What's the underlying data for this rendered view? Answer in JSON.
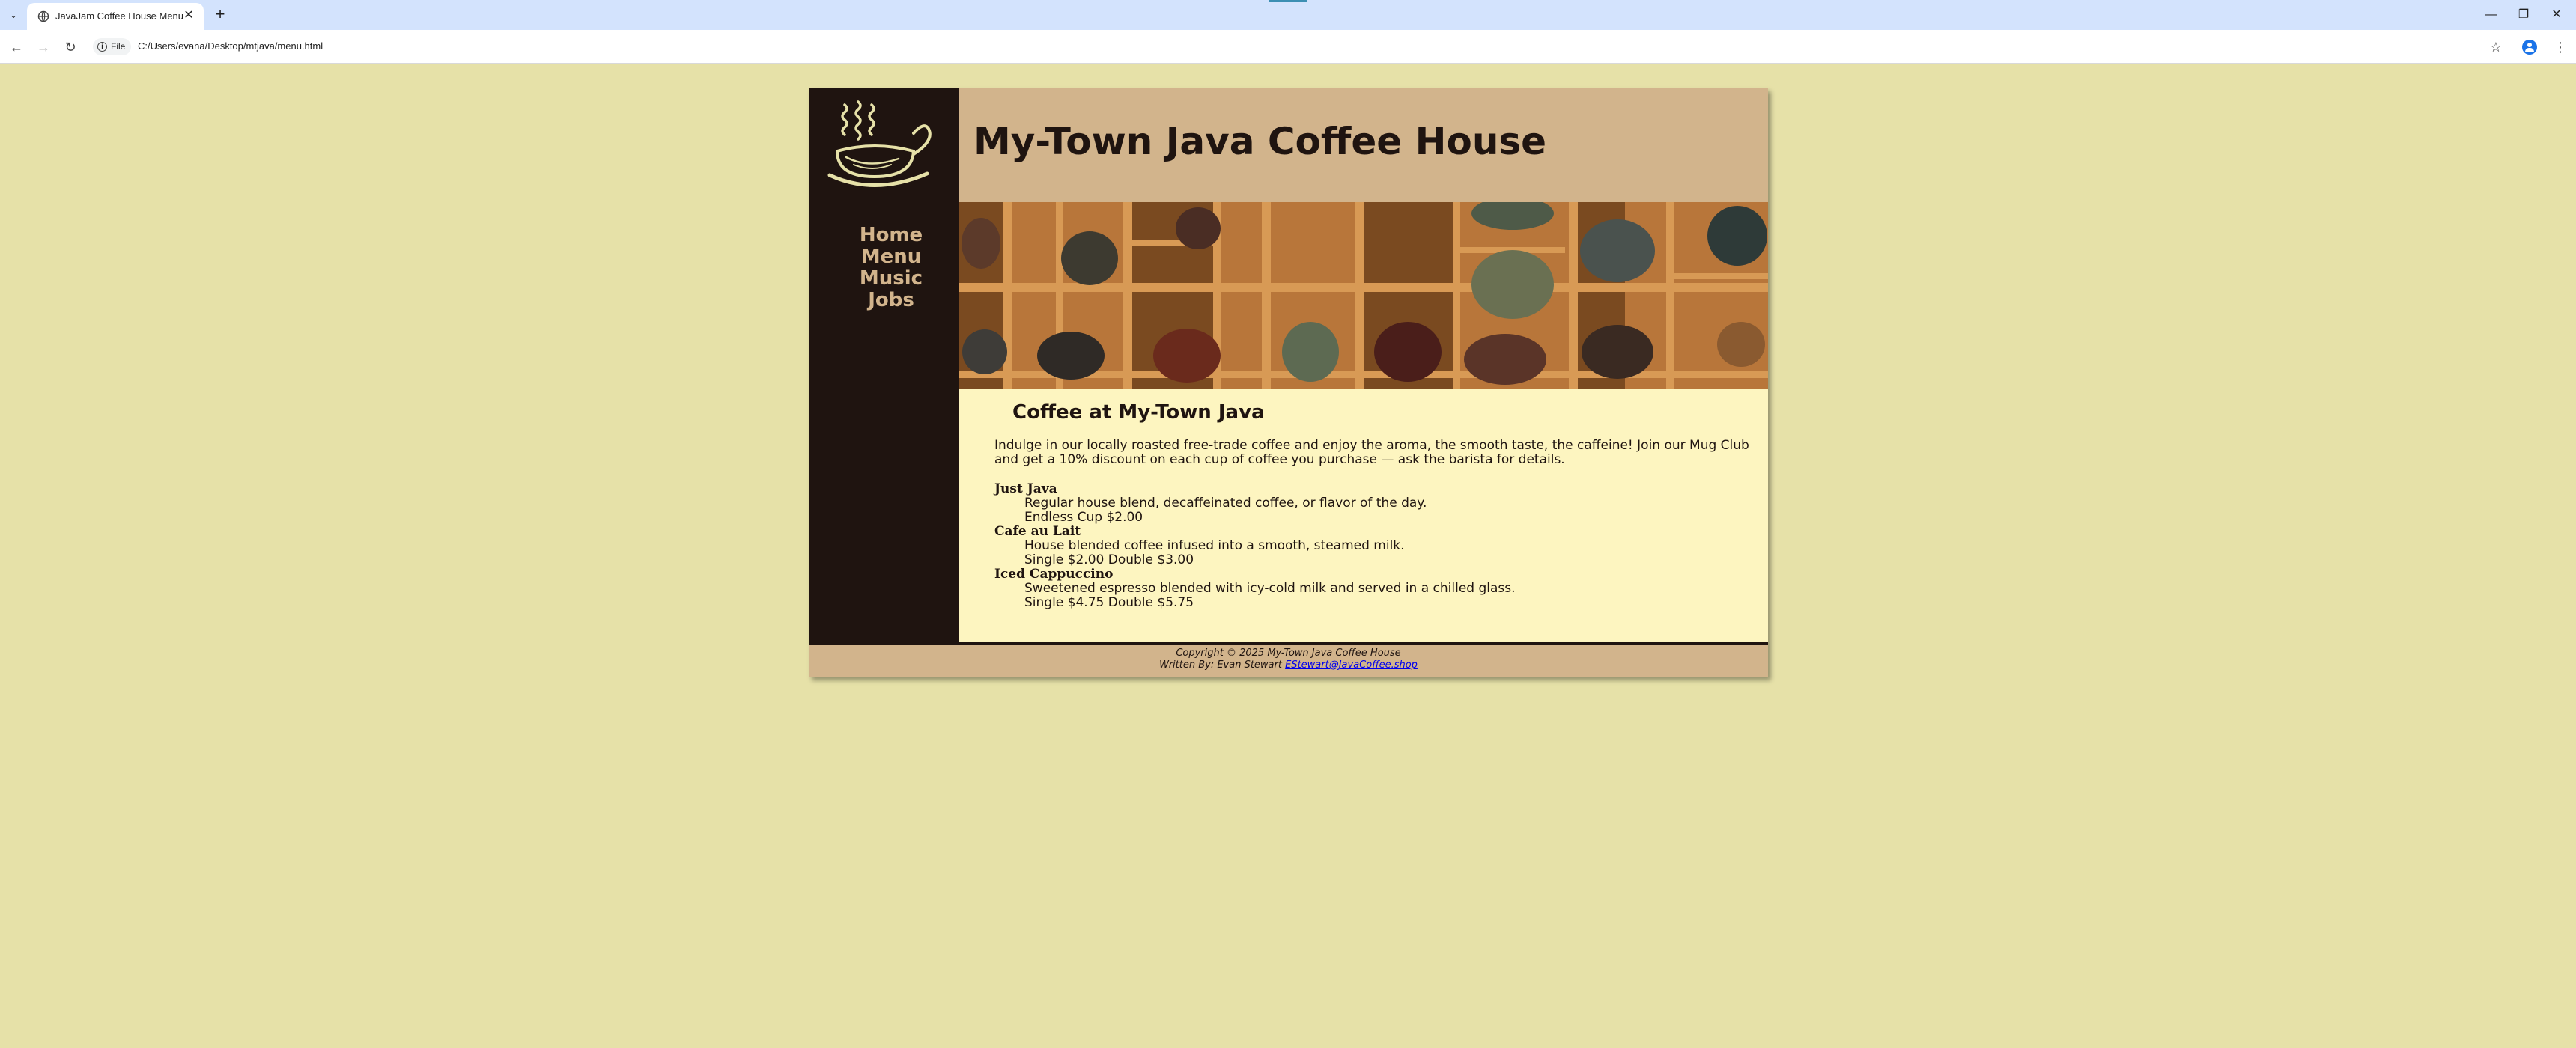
{
  "browser": {
    "tab_title": "JavaJam Coffee House Menu",
    "new_tab_symbol": "+",
    "site_chip_label": "File",
    "url": "C:/Users/evana/Desktop/mtjava/menu.html",
    "icons": [
      "tab-search-icon",
      "page-favicon-icon",
      "close-icon",
      "new-tab-icon",
      "minimize-icon",
      "restore-icon",
      "close-window-icon",
      "back-icon",
      "forward-icon",
      "reload-icon",
      "info-icon",
      "bookmark-star-icon",
      "profile-icon",
      "more-menu-icon"
    ]
  },
  "page": {
    "site_title": "My-Town Java Coffee House",
    "nav": [
      {
        "label": "Home"
      },
      {
        "label": "Menu"
      },
      {
        "label": "Music"
      },
      {
        "label": "Jobs"
      }
    ],
    "heading": "Coffee at My-Town Java",
    "intro": "Indulge in our locally roasted free-trade coffee and enjoy the aroma, the smooth taste, the caffeine! Join our Mug Club and get a 10% discount on each cup of coffee you purchase — ask the barista for details.",
    "menu": [
      {
        "name": "Just Java",
        "description": "Regular house blend, decaffeinated coffee, or flavor of the day.",
        "price": "Endless Cup $2.00"
      },
      {
        "name": "Cafe au Lait",
        "description": "House blended coffee infused into a smooth, steamed milk.",
        "price": "Single $2.00 Double $3.00"
      },
      {
        "name": "Iced Cappuccino",
        "description": "Sweetened espresso blended with icy-cold milk and served in a chilled glass.",
        "price": "Single $4.75 Double $5.75"
      }
    ],
    "footer_copyright": "Copyright © 2025 My-Town Java Coffee House",
    "footer_written_by": "Written By: Evan Stewart",
    "footer_email": "EStewart@JavaCoffee.shop"
  },
  "colors": {
    "page_background": "#e6e1a8",
    "dark_brown": "#1f1410",
    "tan": "#d2b48c",
    "content_background": "#fdf5c0",
    "link": "#0000ee",
    "tabbar": "#d3e3fd"
  }
}
